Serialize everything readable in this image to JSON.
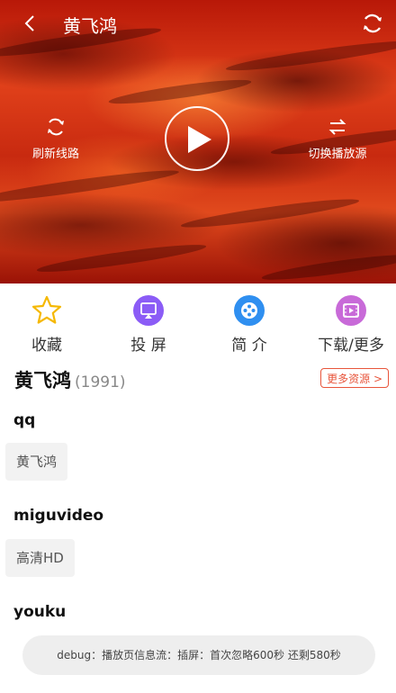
{
  "header": {
    "title": "黄飞鸿"
  },
  "player": {
    "refresh_line_label": "刷新线路",
    "switch_source_label": "切换播放源"
  },
  "actions": [
    {
      "label": "收藏",
      "icon": "star-icon",
      "color": "#f5b800"
    },
    {
      "label": "投 屏",
      "icon": "cast-icon",
      "color": "#8b5cf6"
    },
    {
      "label": "简 介",
      "icon": "film-reel-icon",
      "color": "#2f8ff0"
    },
    {
      "label": "下载/更多",
      "icon": "download-more-icon",
      "color": "#c86ad8"
    }
  ],
  "info": {
    "title": "黄飞鸿",
    "year": "(1991)",
    "more_sources": "更多资源 >"
  },
  "sources": [
    {
      "name": "qq",
      "episodes": [
        "黄飞鸿"
      ]
    },
    {
      "name": "miguvideo",
      "episodes": [
        "高清HD"
      ]
    },
    {
      "name": "youku",
      "episodes": []
    }
  ],
  "debug": {
    "text": "debug：播放页信息流：插屏：首次忽略600秒 还剩580秒"
  }
}
